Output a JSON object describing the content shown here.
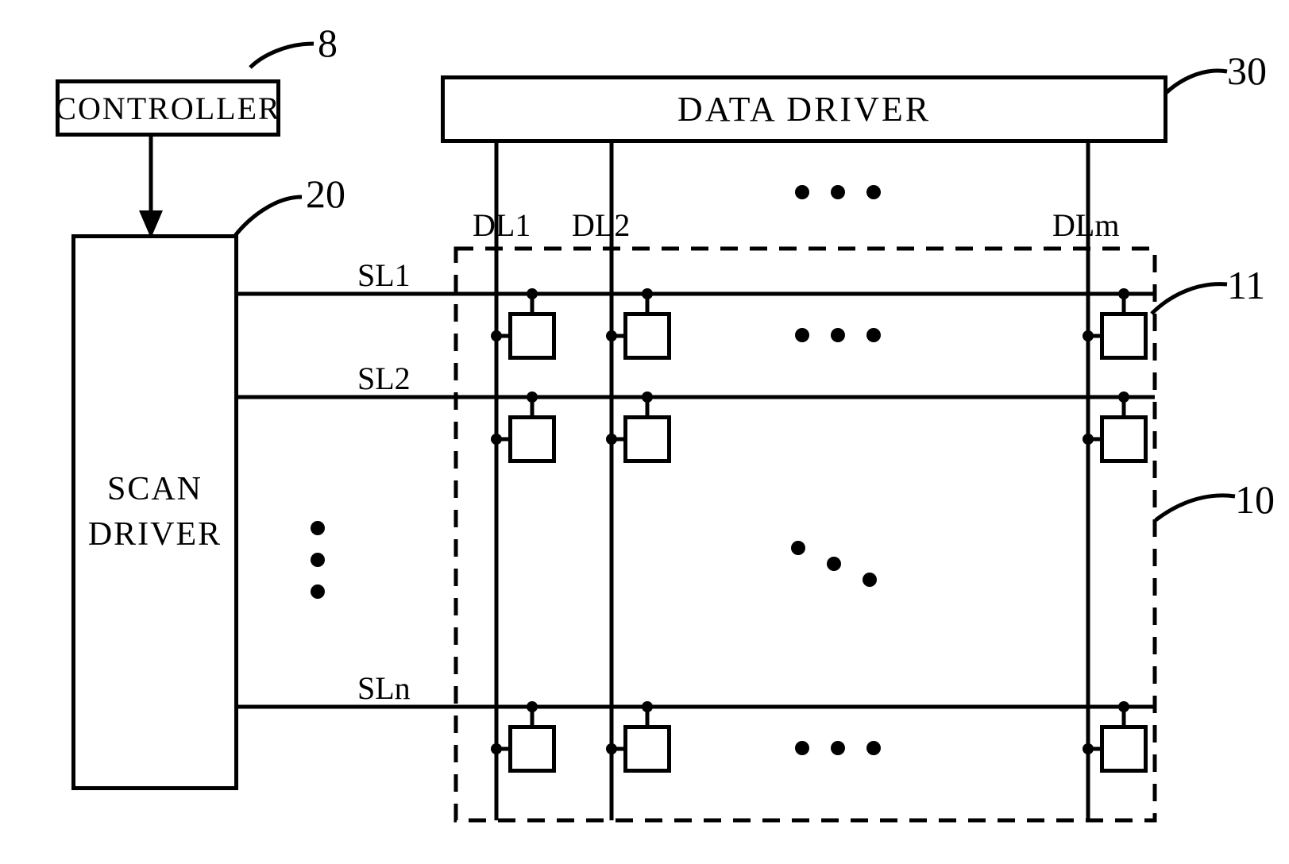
{
  "blocks": {
    "controller": "CONTROLLER",
    "data_driver": "DATA DRIVER",
    "scan_driver": "SCAN\nDRIVER"
  },
  "refs": {
    "controller": "8",
    "scan_driver": "20",
    "data_driver": "30",
    "pixel": "11",
    "panel": "10"
  },
  "data_lines": [
    "DL1",
    "DL2",
    "DLm"
  ],
  "scan_lines": [
    "SL1",
    "SL2",
    "SLn"
  ],
  "ellipsis": "• • •",
  "ellipsis_mid": "•••",
  "vdots": "⋮"
}
